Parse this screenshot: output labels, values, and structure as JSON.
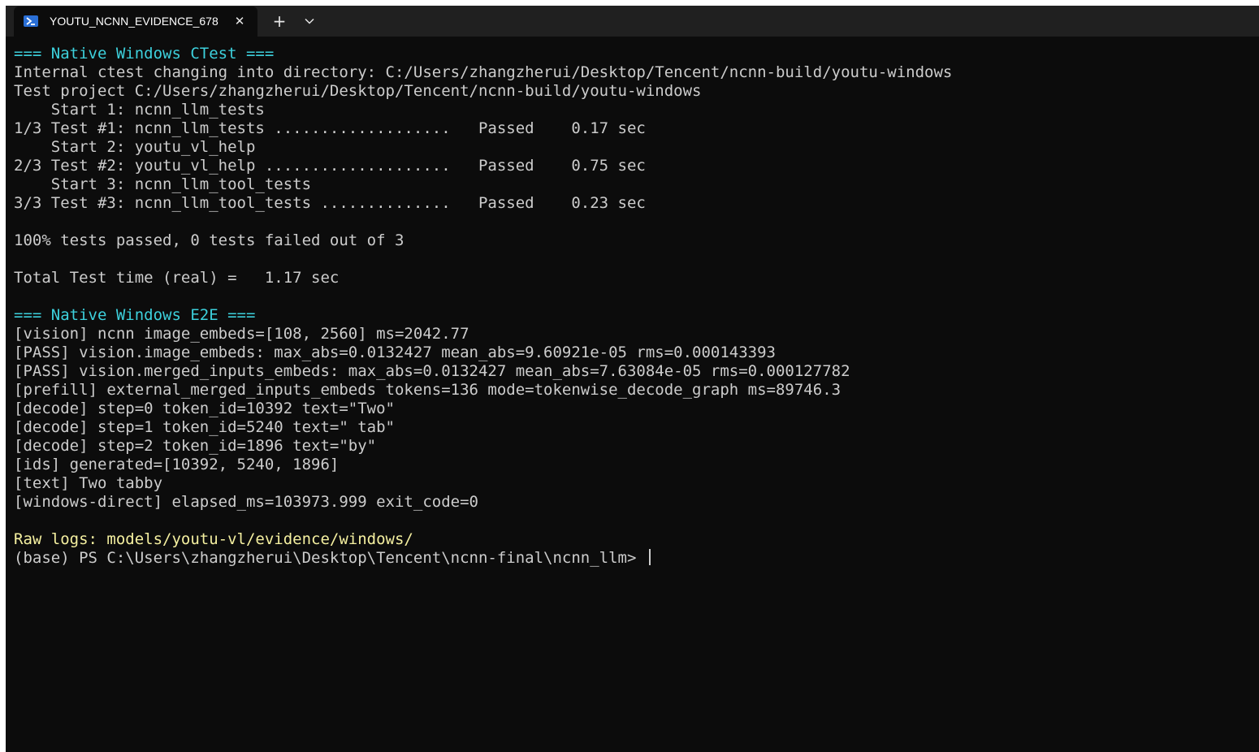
{
  "tab": {
    "icon": "powershell-icon",
    "title": "YOUTU_NCNN_EVIDENCE_678",
    "close_glyph": "✕",
    "new_tab_glyph": "+",
    "menu_icon": "chevron-down-icon"
  },
  "colors": {
    "background": "#0c0c0c",
    "text": "#cccccc",
    "heading": "#3dd0dc",
    "highlight": "#f5f0a0"
  },
  "terminal": {
    "lines": [
      "=== Native Windows CTest ===",
      "Internal ctest changing into directory: C:/Users/zhangzherui/Desktop/Tencent/ncnn-build/youtu-windows",
      "Test project C:/Users/zhangzherui/Desktop/Tencent/ncnn-build/youtu-windows",
      "    Start 1: ncnn_llm_tests",
      "1/3 Test #1: ncnn_llm_tests ...................   Passed    0.17 sec",
      "    Start 2: youtu_vl_help",
      "2/3 Test #2: youtu_vl_help ....................   Passed    0.75 sec",
      "    Start 3: ncnn_llm_tool_tests",
      "3/3 Test #3: ncnn_llm_tool_tests ..............   Passed    0.23 sec",
      "",
      "100% tests passed, 0 tests failed out of 3",
      "",
      "Total Test time (real) =   1.17 sec",
      "",
      "=== Native Windows E2E ===",
      "[vision] ncnn image_embeds=[108, 2560] ms=2042.77",
      "[PASS] vision.image_embeds: max_abs=0.0132427 mean_abs=9.60921e-05 rms=0.000143393",
      "[PASS] vision.merged_inputs_embeds: max_abs=0.0132427 mean_abs=7.63084e-05 rms=0.000127782",
      "[prefill] external_merged_inputs_embeds tokens=136 mode=tokenwise_decode_graph ms=89746.3",
      "[decode] step=0 token_id=10392 text=\"Two\"",
      "[decode] step=1 token_id=5240 text=\" tab\"",
      "[decode] step=2 token_id=1896 text=\"by\"",
      "[ids] generated=[10392, 5240, 1896]",
      "[text] Two tabby",
      "[windows-direct] elapsed_ms=103973.999 exit_code=0",
      "",
      "Raw logs: models/youtu-vl/evidence/windows/"
    ],
    "prompt": "(base) PS C:\\Users\\zhangzherui\\Desktop\\Tencent\\ncnn-final\\ncnn_llm> "
  }
}
